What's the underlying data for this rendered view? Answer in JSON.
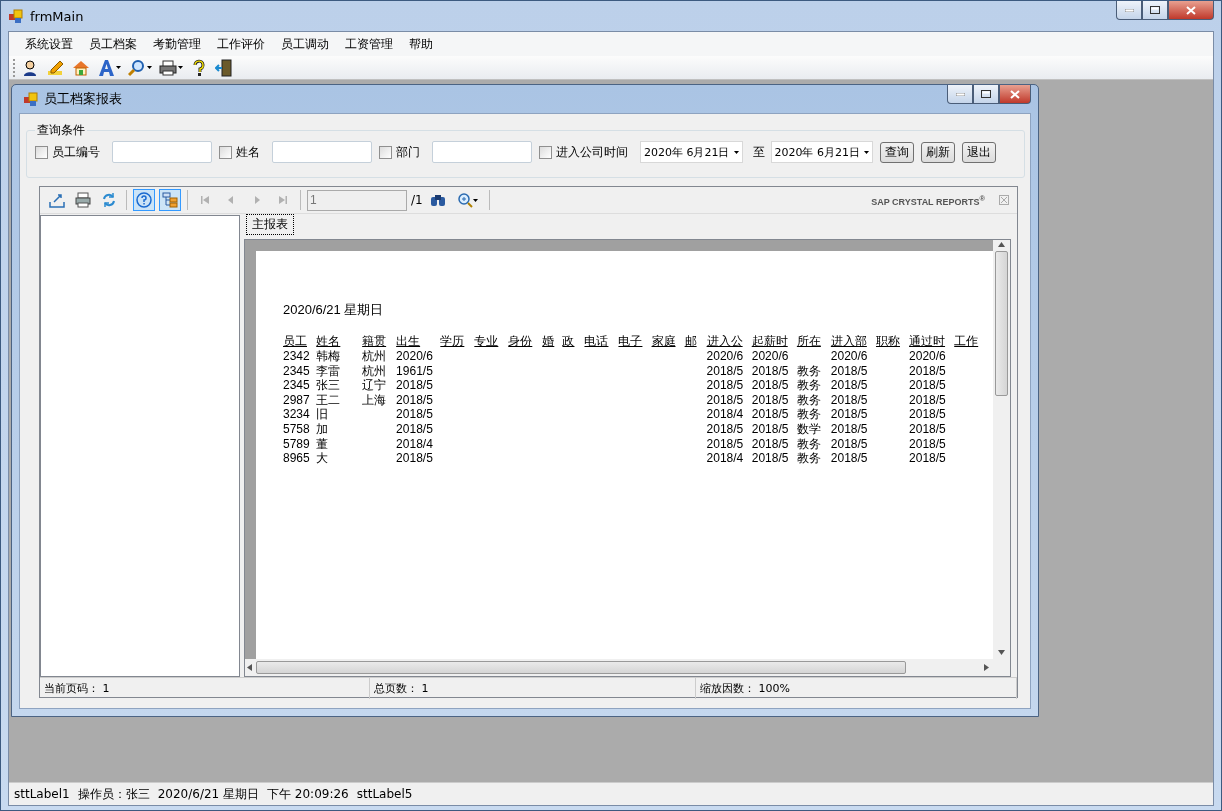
{
  "window": {
    "title": "frmMain"
  },
  "menu": [
    "系统设置",
    "员工档案",
    "考勤管理",
    "工作评价",
    "员工调动",
    "工资管理",
    "帮助"
  ],
  "toolbar": [
    {
      "kind": "person",
      "dropdown": false
    },
    {
      "kind": "pencil",
      "dropdown": false
    },
    {
      "kind": "home",
      "dropdown": false
    },
    {
      "kind": "font",
      "dropdown": true
    },
    {
      "kind": "search",
      "dropdown": true
    },
    {
      "kind": "printer",
      "dropdown": true
    },
    {
      "kind": "help",
      "dropdown": false
    },
    {
      "kind": "exit",
      "dropdown": false
    }
  ],
  "child_window": {
    "title": "员工档案报表"
  },
  "query": {
    "legend": "查询条件",
    "filters": [
      {
        "label": "员工编号",
        "checked": false
      },
      {
        "label": "姓名",
        "checked": false
      },
      {
        "label": "部门",
        "checked": false
      }
    ],
    "date_filter": {
      "label": "进入公司时间",
      "checked": false,
      "from": "2020年 6月21日",
      "separator": "至",
      "to": "2020年 6月21日"
    },
    "buttons": [
      "查询",
      "刷新",
      "退出"
    ]
  },
  "viewer": {
    "tools": [
      {
        "kind": "export",
        "pressed": false,
        "disabled": false
      },
      {
        "kind": "print",
        "pressed": false,
        "disabled": false
      },
      {
        "kind": "refresh",
        "pressed": false,
        "disabled": false
      },
      {
        "kind": "parameters",
        "pressed": true,
        "disabled": false
      },
      {
        "kind": "group-tree",
        "pressed": true,
        "disabled": false
      },
      {
        "kind": "first",
        "pressed": false,
        "disabled": true
      },
      {
        "kind": "prev",
        "pressed": false,
        "disabled": true
      },
      {
        "kind": "next",
        "pressed": false,
        "disabled": true
      },
      {
        "kind": "last",
        "pressed": false,
        "disabled": true
      }
    ],
    "page_field": "1",
    "page_total": "/1",
    "brand": "SAP CRYSTAL REPORTS$^{®}$",
    "tabs": [
      {
        "label": "主报表",
        "selected": true
      }
    ],
    "report": {
      "date": "2020/6/21 星期日",
      "columns": [
        "员工",
        "姓名",
        null,
        "籍贯",
        "出生",
        "学历",
        "专业",
        "身份",
        "婚",
        "政",
        "电话",
        "电子",
        "家庭",
        "邮",
        "进入公",
        "起薪时",
        "所在",
        "进入部",
        "职称",
        "通过时",
        "工作"
      ],
      "rows": [
        [
          "2342",
          "韩梅",
          null,
          "杭州",
          "2020/6",
          null,
          null,
          null,
          null,
          null,
          null,
          null,
          null,
          null,
          "2020/6",
          "2020/6",
          null,
          "2020/6",
          null,
          "2020/6",
          null
        ],
        [
          "2345",
          "李雷",
          null,
          "杭州",
          "1961/5",
          null,
          null,
          null,
          null,
          null,
          null,
          null,
          null,
          null,
          "2018/5",
          "2018/5",
          "教务",
          "2018/5",
          null,
          "2018/5",
          null
        ],
        [
          "2345",
          "张三",
          null,
          "辽宁",
          "2018/5",
          null,
          null,
          null,
          null,
          null,
          null,
          null,
          null,
          null,
          "2018/5",
          "2018/5",
          "教务",
          "2018/5",
          null,
          "2018/5",
          null
        ],
        [
          "2987",
          "王二",
          null,
          "上海",
          "2018/5",
          null,
          null,
          null,
          null,
          null,
          null,
          null,
          null,
          null,
          "2018/5",
          "2018/5",
          "教务",
          "2018/5",
          null,
          "2018/5",
          null
        ],
        [
          "3234",
          "旧",
          null,
          null,
          "2018/5",
          null,
          null,
          null,
          null,
          null,
          null,
          null,
          null,
          null,
          "2018/4",
          "2018/5",
          "教务",
          "2018/5",
          null,
          "2018/5",
          null
        ],
        [
          "5758",
          "加",
          null,
          null,
          "2018/5",
          null,
          null,
          null,
          null,
          null,
          null,
          null,
          null,
          null,
          "2018/5",
          "2018/5",
          "数学",
          "2018/5",
          null,
          "2018/5",
          null
        ],
        [
          "5789",
          "董",
          null,
          null,
          "2018/4",
          null,
          null,
          null,
          null,
          null,
          null,
          null,
          null,
          null,
          "2018/5",
          "2018/5",
          "教务",
          "2018/5",
          null,
          "2018/5",
          null
        ],
        [
          "8965",
          "大",
          null,
          null,
          "2018/5",
          null,
          null,
          null,
          null,
          null,
          null,
          null,
          null,
          null,
          "2018/4",
          "2018/5",
          "教务",
          "2018/5",
          null,
          "2018/5",
          null
        ]
      ]
    },
    "status": [
      "当前页码： 1",
      "总页数： 1",
      "缩放因数： 100%"
    ]
  },
  "status_bar": [
    "sttLabel1",
    "操作员：张三",
    "2020/6/21 星期日",
    "下午 20:09:26",
    "sttLabel5"
  ]
}
